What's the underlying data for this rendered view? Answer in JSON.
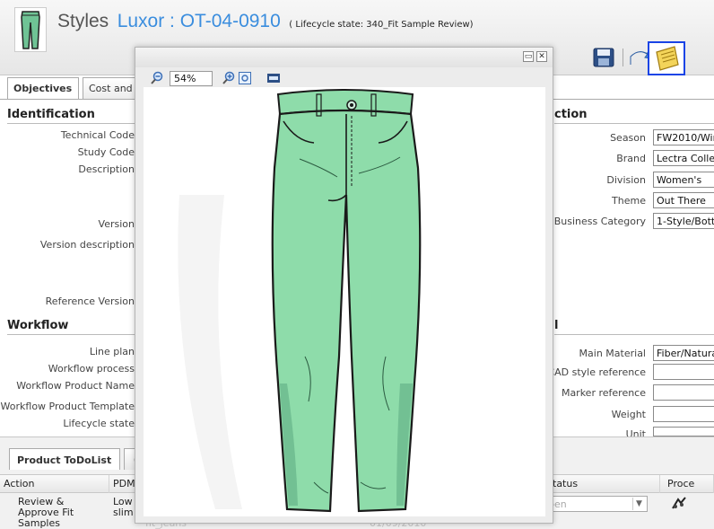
{
  "header": {
    "title_prefix": "Styles",
    "title_id": "Luxor : OT-04-0910",
    "lifecycle_text": "( Lifecycle state: 340_Fit Sample Review)"
  },
  "toolbar": {
    "save_icon": "save-icon",
    "undo_icon": "undo-icon",
    "note_icon": "note-icon"
  },
  "tabs": [
    {
      "label": "Objectives"
    },
    {
      "label": "Cost and"
    }
  ],
  "identification": {
    "title": "Identification",
    "labels": [
      "Technical Code",
      "Study Code",
      "Description",
      "Version",
      "Version description",
      "Reference Version"
    ]
  },
  "workflow": {
    "title": "Workflow",
    "labels": [
      "Line plan",
      "Workflow process",
      "Workflow Product Name",
      "Workflow Product Template",
      "Lifecycle state"
    ]
  },
  "right_section": {
    "title_fragment": "ction",
    "fields": [
      {
        "label": "Season",
        "value": "FW2010/Win"
      },
      {
        "label": "Brand",
        "value": "Lectra Collec"
      },
      {
        "label": "Division",
        "value": "Women's"
      },
      {
        "label": "Theme",
        "value": "Out There"
      },
      {
        "label": "Business Category",
        "value": "1-Style/Botto"
      }
    ],
    "title2_fragment": "l",
    "fields2": [
      {
        "label": "Main Material",
        "value": "Fiber/Natural"
      },
      {
        "label": "CAD style reference",
        "value": ""
      },
      {
        "label": "Marker reference",
        "value": ""
      },
      {
        "label": "Weight",
        "value": ""
      },
      {
        "label": "Unit",
        "value": ""
      }
    ]
  },
  "bottom": {
    "tab_label": "Product ToDoList",
    "tab2_label": "C",
    "columns": [
      "Action",
      "PDM",
      "tatus",
      "Proce"
    ],
    "row": {
      "action": [
        "Review &",
        "Approve Fit",
        "Samples"
      ],
      "pdm": [
        "Low",
        "slim"
      ],
      "pdm_faded": "fit_jeans",
      "faded_value": "01/09/2010",
      "status": "pen"
    }
  },
  "viewer": {
    "zoom_value": "54%",
    "zoom_out_icon": "zoom-out-icon",
    "zoom_in_icon": "zoom-in-icon",
    "fit_icon": "fit-window-icon",
    "actual_size_icon": "actual-size-icon",
    "restore_icon": "restore-icon",
    "close_icon": "close-icon",
    "image_subject": "green-jeans-sketch",
    "jeans_color": "#8edcaa"
  }
}
